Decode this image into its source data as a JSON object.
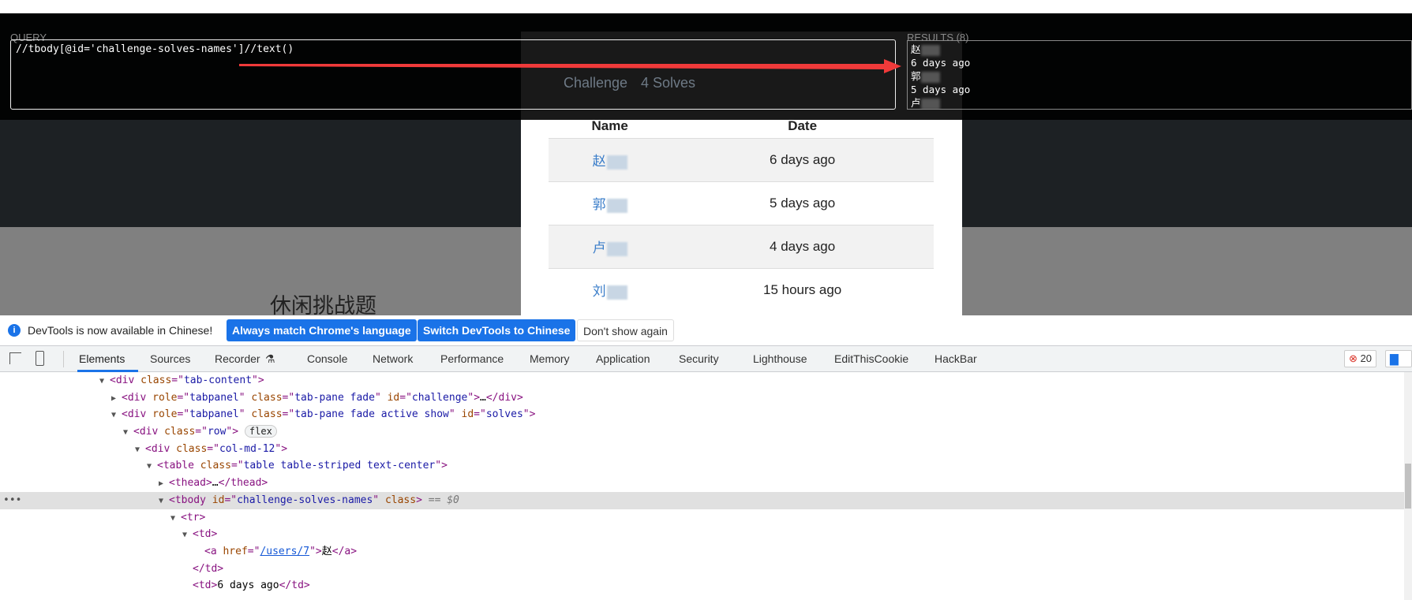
{
  "page": {
    "heading": "休闲挑战题"
  },
  "modal": {
    "tabs": [
      "Challenge",
      "4 Solves"
    ],
    "columns": [
      "Name",
      "Date"
    ],
    "rows": [
      {
        "name": "赵",
        "date": "6 days ago"
      },
      {
        "name": "郭",
        "date": "5 days ago"
      },
      {
        "name": "卢",
        "date": "4 days ago"
      },
      {
        "name": "刘",
        "date": "15 hours ago"
      }
    ]
  },
  "xpath": {
    "query_label": "QUERY",
    "query": "//tbody[@id='challenge-solves-names']//text()",
    "results_label": "RESULTS (8)",
    "results": [
      "赵",
      "6 days ago",
      "郭",
      "5 days ago",
      "卢"
    ]
  },
  "notice": {
    "text": "DevTools is now available in Chinese!",
    "btn_match": "Always match Chrome's language",
    "btn_switch": "Switch DevTools to Chinese",
    "btn_dismiss": "Don't show again"
  },
  "devtools": {
    "tabs": [
      "Elements",
      "Sources",
      "Recorder",
      "Console",
      "Network",
      "Performance",
      "Memory",
      "Application",
      "Security",
      "Lighthouse",
      "EditThisCookie",
      "HackBar"
    ],
    "active_tab": "Elements",
    "error_count": "20",
    "tree": [
      {
        "level": 0,
        "tri": "▼",
        "html": "<div class=\"tab-content\">"
      },
      {
        "level": 1,
        "tri": "▶",
        "html": "<div role=\"tabpanel\" class=\"tab-pane fade\" id=\"challenge\">…</div>"
      },
      {
        "level": 1,
        "tri": "▼",
        "html": "<div role=\"tabpanel\" class=\"tab-pane fade active show\" id=\"solves\">"
      },
      {
        "level": 2,
        "tri": "▼",
        "html": "<div class=\"row\">",
        "badge": "flex"
      },
      {
        "level": 3,
        "tri": "▼",
        "html": "<div class=\"col-md-12\">"
      },
      {
        "level": 4,
        "tri": "▼",
        "html": "<table class=\"table table-striped text-center\">"
      },
      {
        "level": 5,
        "tri": "▶",
        "html": "<thead>…</thead>"
      },
      {
        "level": 5,
        "tri": "▼",
        "html": "<tbody id=\"challenge-solves-names\" class>",
        "suffix": " == $0",
        "selected": true
      },
      {
        "level": 6,
        "tri": "▼",
        "html": "<tr>"
      },
      {
        "level": 7,
        "tri": "▼",
        "html": "<td>"
      },
      {
        "level": 8,
        "tri": "",
        "html": "<a href=\"/users/7\">赵</a>"
      },
      {
        "level": 7,
        "tri": "",
        "html": "</td>"
      },
      {
        "level": 7,
        "tri": "",
        "html": "<td>6 days ago</td>"
      }
    ]
  },
  "colors": {
    "accent": "#1a73e8",
    "arrow": "#f03a3a",
    "tag": "#881280",
    "attr_name": "#994500",
    "attr_value": "#1a1aa6"
  }
}
